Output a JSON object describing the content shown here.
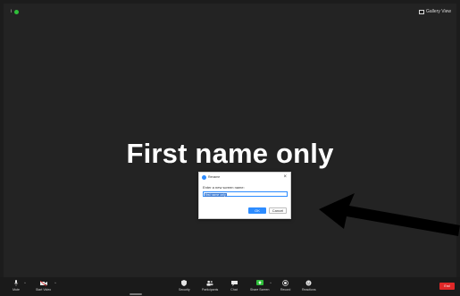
{
  "topbar": {
    "info_label": "i",
    "view_label": "Gallery View"
  },
  "participant": {
    "display_name": "First name only"
  },
  "dialog": {
    "title": "Rename",
    "prompt": "Enter a new screen name:",
    "input_value": "first name only",
    "ok_label": "OK",
    "cancel_label": "Cancel",
    "close_glyph": "×"
  },
  "toolbar": {
    "mute_label": "Mute",
    "video_label": "Start Video",
    "security_label": "Security",
    "participants_label": "Participants",
    "participants_count": "1",
    "chat_label": "Chat",
    "share_label": "Share Screen",
    "record_label": "Record",
    "reactions_label": "Reactions",
    "end_label": "End"
  },
  "colors": {
    "accent": "#2d8cff",
    "share_green": "#2fbf3a",
    "end_red": "#e02828"
  }
}
